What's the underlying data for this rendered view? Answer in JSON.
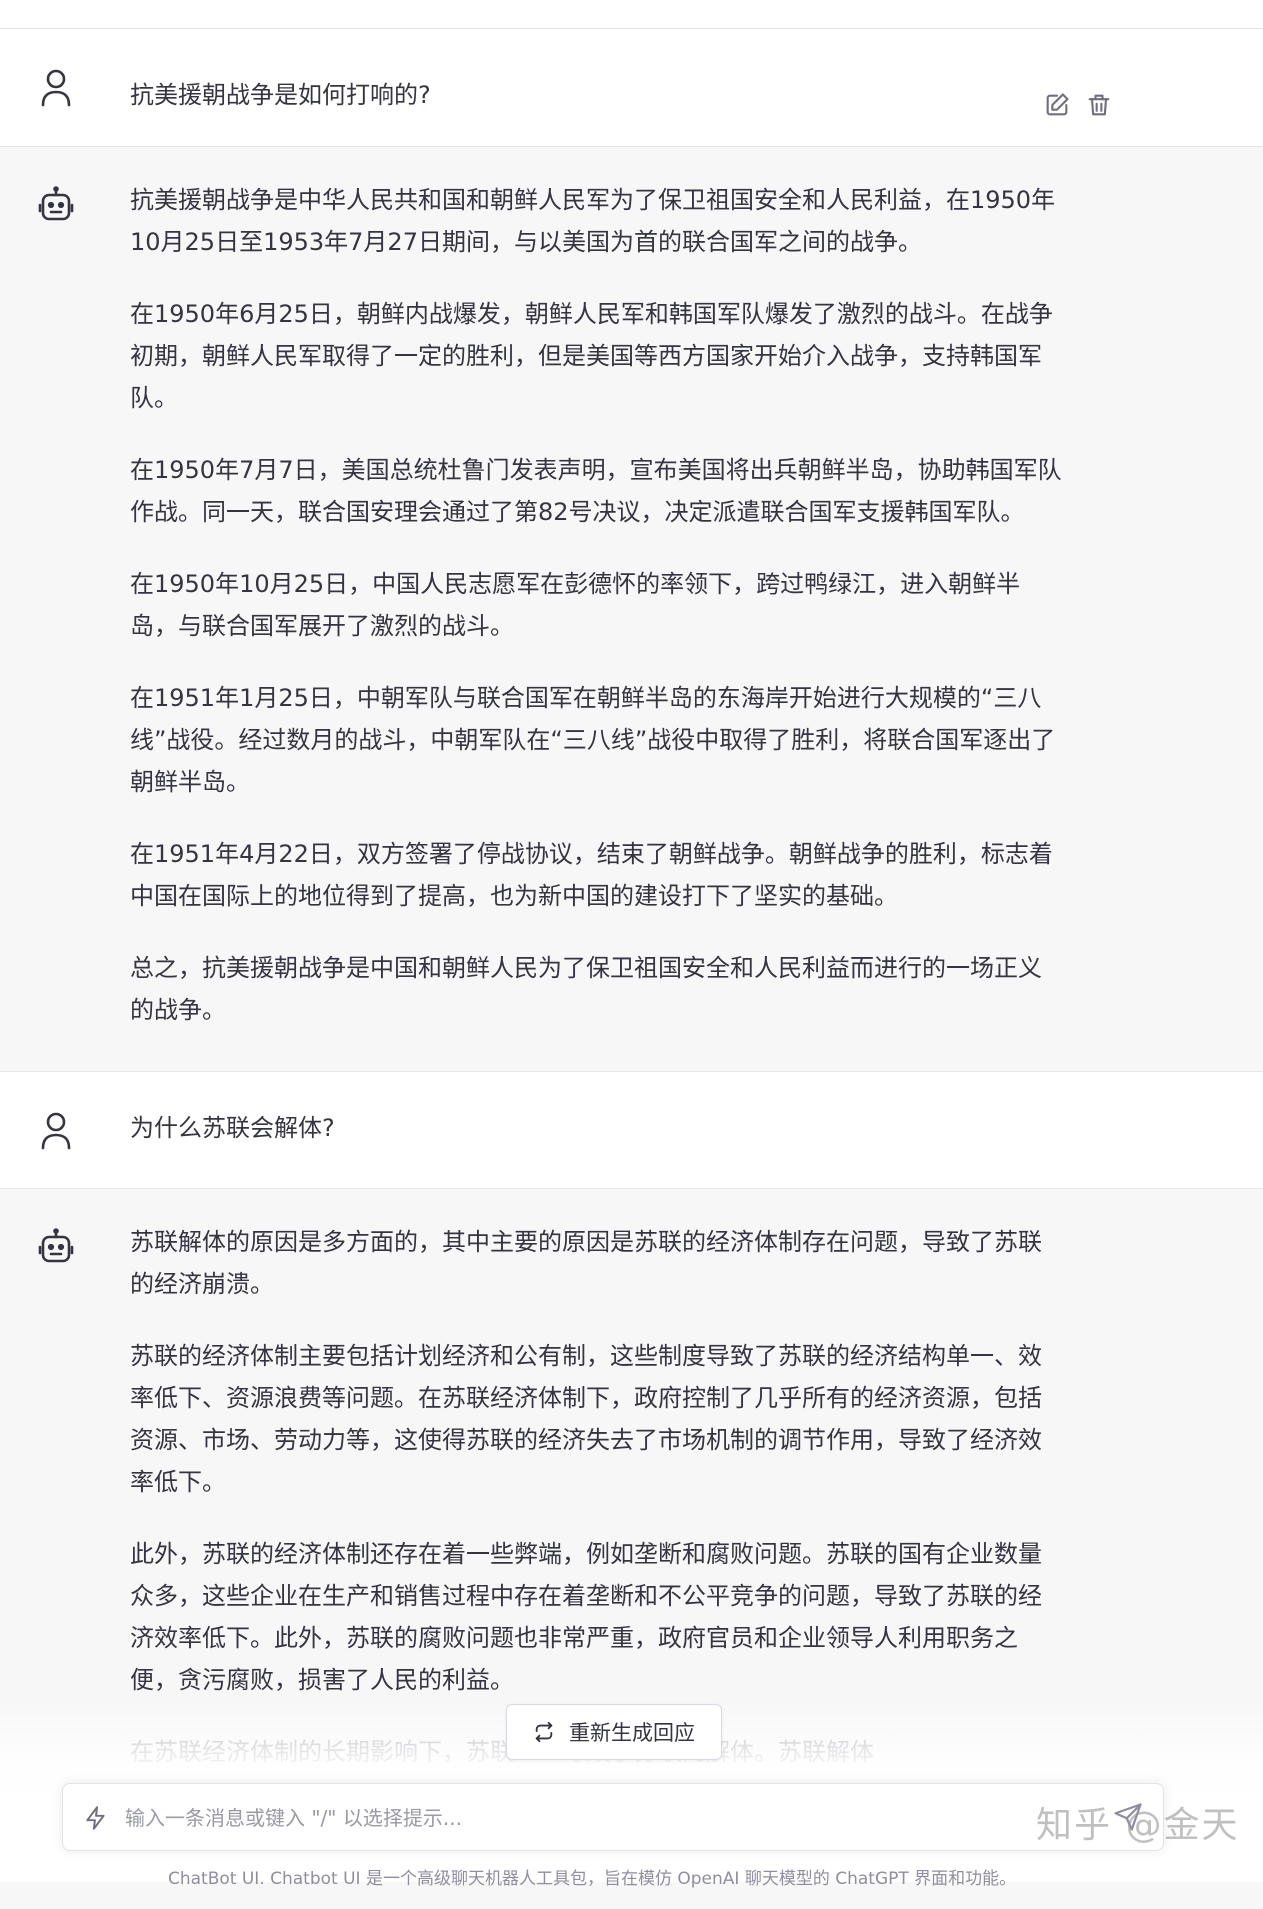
{
  "conversation": [
    {
      "role": "user",
      "text": "抗美援朝战争是如何打响的?"
    },
    {
      "role": "assistant",
      "paragraphs": [
        "抗美援朝战争是中华人民共和国和朝鲜人民军为了保卫祖国安全和人民利益，在1950年10月25日至1953年7月27日期间，与以美国为首的联合国军之间的战争。",
        "在1950年6月25日，朝鲜内战爆发，朝鲜人民军和韩国军队爆发了激烈的战斗。在战争初期，朝鲜人民军取得了一定的胜利，但是美国等西方国家开始介入战争，支持韩国军队。",
        "在1950年7月7日，美国总统杜鲁门发表声明，宣布美国将出兵朝鲜半岛，协助韩国军队作战。同一天，联合国安理会通过了第82号决议，决定派遣联合国军支援韩国军队。",
        "在1950年10月25日，中国人民志愿军在彭德怀的率领下，跨过鸭绿江，进入朝鲜半岛，与联合国军展开了激烈的战斗。",
        "在1951年1月25日，中朝军队与联合国军在朝鲜半岛的东海岸开始进行大规模的“三八线”战役。经过数月的战斗，中朝军队在“三八线”战役中取得了胜利，将联合国军逐出了朝鲜半岛。",
        "在1951年4月22日，双方签署了停战协议，结束了朝鲜战争。朝鲜战争的胜利，标志着中国在国际上的地位得到了提高，也为新中国的建设打下了坚实的基础。",
        "总之，抗美援朝战争是中国和朝鲜人民为了保卫祖国安全和人民利益而进行的一场正义的战争。"
      ]
    },
    {
      "role": "user",
      "text": "为什么苏联会解体?"
    },
    {
      "role": "assistant",
      "paragraphs": [
        "苏联解体的原因是多方面的，其中主要的原因是苏联的经济体制存在问题，导致了苏联的经济崩溃。",
        "苏联的经济体制主要包括计划经济和公有制，这些制度导致了苏联的经济结构单一、效率低下、资源浪费等问题。在苏联经济体制下，政府控制了几乎所有的经济资源，包括资源、市场、劳动力等，这使得苏联的经济失去了市场机制的调节作用，导致了经济效率低下。",
        "此外，苏联的经济体制还存在着一些弊端，例如垄断和腐败问题。苏联的国有企业数量众多，这些企业在生产和销售过程中存在着垄断和不公平竞争的问题，导致了苏联的经济效率低下。此外，苏联的腐败问题也非常严重，政府官员和企业领导人利用职务之便，贪污腐败，损害了人民的利益。",
        "在苏联经济体制的长期影响下，苏联……导致了苏联的解体。苏联解体"
      ]
    }
  ],
  "regenerate": {
    "label": "重新生成回应"
  },
  "input": {
    "placeholder": "输入一条消息或键入 \"/\" 以选择提示..."
  },
  "footer": {
    "text": "ChatBot UI. Chatbot UI 是一个高级聊天机器人工具包，旨在模仿 OpenAI 聊天模型的 ChatGPT 界面和功能。"
  },
  "watermark": {
    "text": "知乎 @金天"
  },
  "icons": {
    "user_avatar": "user-icon",
    "bot_avatar": "robot-icon",
    "edit": "edit-icon",
    "delete": "trash-icon",
    "regenerate": "refresh-icon",
    "input_prompt": "bolt-icon",
    "send": "send-icon"
  }
}
